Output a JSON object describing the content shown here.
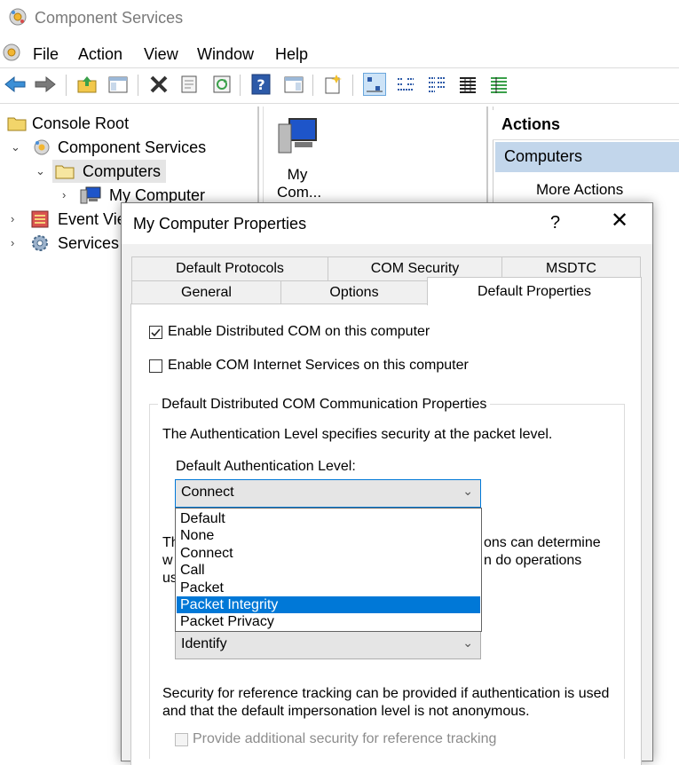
{
  "window": {
    "title": "Component Services"
  },
  "menu": {
    "items": [
      "File",
      "Action",
      "View",
      "Window",
      "Help"
    ]
  },
  "toolbar": {
    "icons": [
      "back-arrow-icon",
      "forward-arrow-icon",
      "up-folder-icon",
      "show-hide-tree-icon",
      "delete-icon",
      "properties-icon",
      "refresh-icon",
      "help-icon",
      "show-action-pane-icon",
      "new-icon",
      "large-icons-view-icon",
      "small-icons-view-icon",
      "list-view-icon",
      "detail-view-icon",
      "status-view-icon"
    ]
  },
  "tree": {
    "items": [
      {
        "label": "Console Root"
      },
      {
        "label": "Component Services"
      },
      {
        "label": "Computers"
      },
      {
        "label": "My Computer"
      },
      {
        "label": "Event Vie"
      },
      {
        "label": "Services ("
      }
    ]
  },
  "result": {
    "item_label_line1": "My",
    "item_label_line2": "Com..."
  },
  "actions": {
    "header": "Actions",
    "section": "Computers",
    "more": "More Actions"
  },
  "dialog": {
    "title": "My Computer Properties",
    "help": "?",
    "close": "✕",
    "tabs_row1": [
      "Default Protocols",
      "COM Security",
      "MSDTC"
    ],
    "tabs_row2": [
      "General",
      "Options",
      "Default Properties"
    ],
    "enable_dcom": {
      "label": "Enable Distributed COM on this computer",
      "checked": true
    },
    "enable_cis": {
      "label": "Enable COM Internet Services on this computer",
      "checked": false
    },
    "group_title": "Default Distributed COM Communication Properties",
    "auth_desc": "The Authentication Level specifies security at the packet level.",
    "auth_label": "Default Authentication Level:",
    "auth_value": "Connect",
    "auth_options": [
      "Default",
      "None",
      "Connect",
      "Call",
      "Packet",
      "Packet Integrity",
      "Packet Privacy"
    ],
    "auth_highlighted": "Packet Integrity",
    "imp_desc_line1_start": "Th",
    "imp_desc_line1_end": "ons can determine",
    "imp_desc_line2_start": "w",
    "imp_desc_line2_end": "n do operations",
    "imp_desc_line3_start": "us",
    "imp_value": "Identify",
    "ref_desc_line1": "Security for reference tracking can be provided if authentication is used",
    "ref_desc_line2": "and that the default impersonation level is not anonymous.",
    "ref_tracking": {
      "label": "Provide additional security for reference tracking",
      "checked": false
    }
  }
}
